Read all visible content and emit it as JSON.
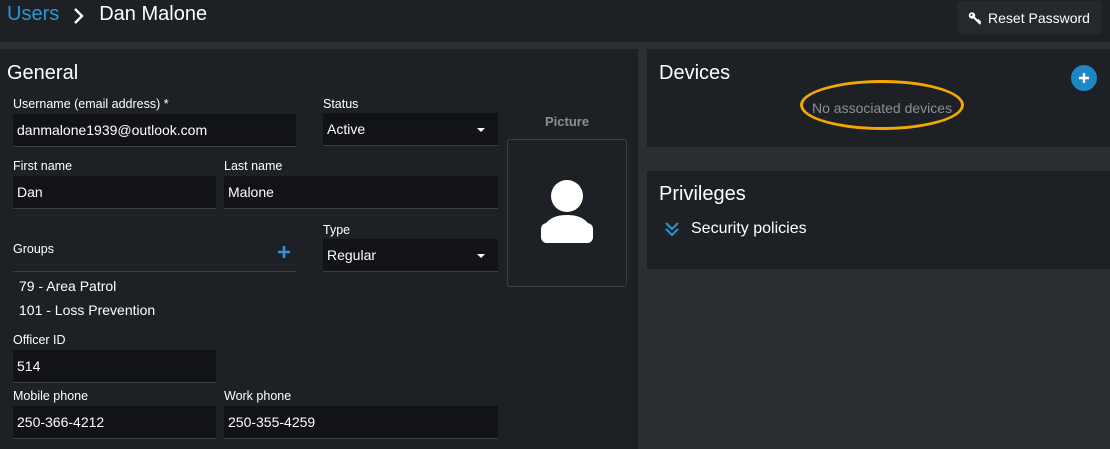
{
  "breadcrumb": {
    "parent": "Users",
    "current": "Dan Malone"
  },
  "header": {
    "reset_password_label": "Reset Password"
  },
  "general": {
    "title": "General",
    "username_label": "Username (email address) *",
    "username_value": "danmalone1939@outlook.com",
    "status_label": "Status",
    "status_value": "Active",
    "first_name_label": "First name",
    "first_name_value": "Dan",
    "last_name_label": "Last name",
    "last_name_value": "Malone",
    "groups_label": "Groups",
    "groups": [
      "79 - Area Patrol",
      "101 - Loss Prevention"
    ],
    "type_label": "Type",
    "type_value": "Regular",
    "officer_id_label": "Officer ID",
    "officer_id_value": "514",
    "mobile_phone_label": "Mobile phone",
    "mobile_phone_value": "250-366-4212",
    "work_phone_label": "Work phone",
    "work_phone_value": "250-355-4259",
    "picture_label": "Picture"
  },
  "devices": {
    "title": "Devices",
    "empty_text": "No associated devices"
  },
  "privileges": {
    "title": "Privileges",
    "security_policies_label": "Security policies"
  },
  "colors": {
    "accent": "#2e95d6",
    "highlight": "#f2a900",
    "panel": "#1d2024",
    "field": "#111316",
    "background": "#2b2e32"
  },
  "icons": [
    "chevron-right-icon",
    "key-icon",
    "caret-down-icon",
    "plus-icon",
    "user-avatar-icon",
    "add-circle-icon",
    "double-chevron-down-icon"
  ]
}
